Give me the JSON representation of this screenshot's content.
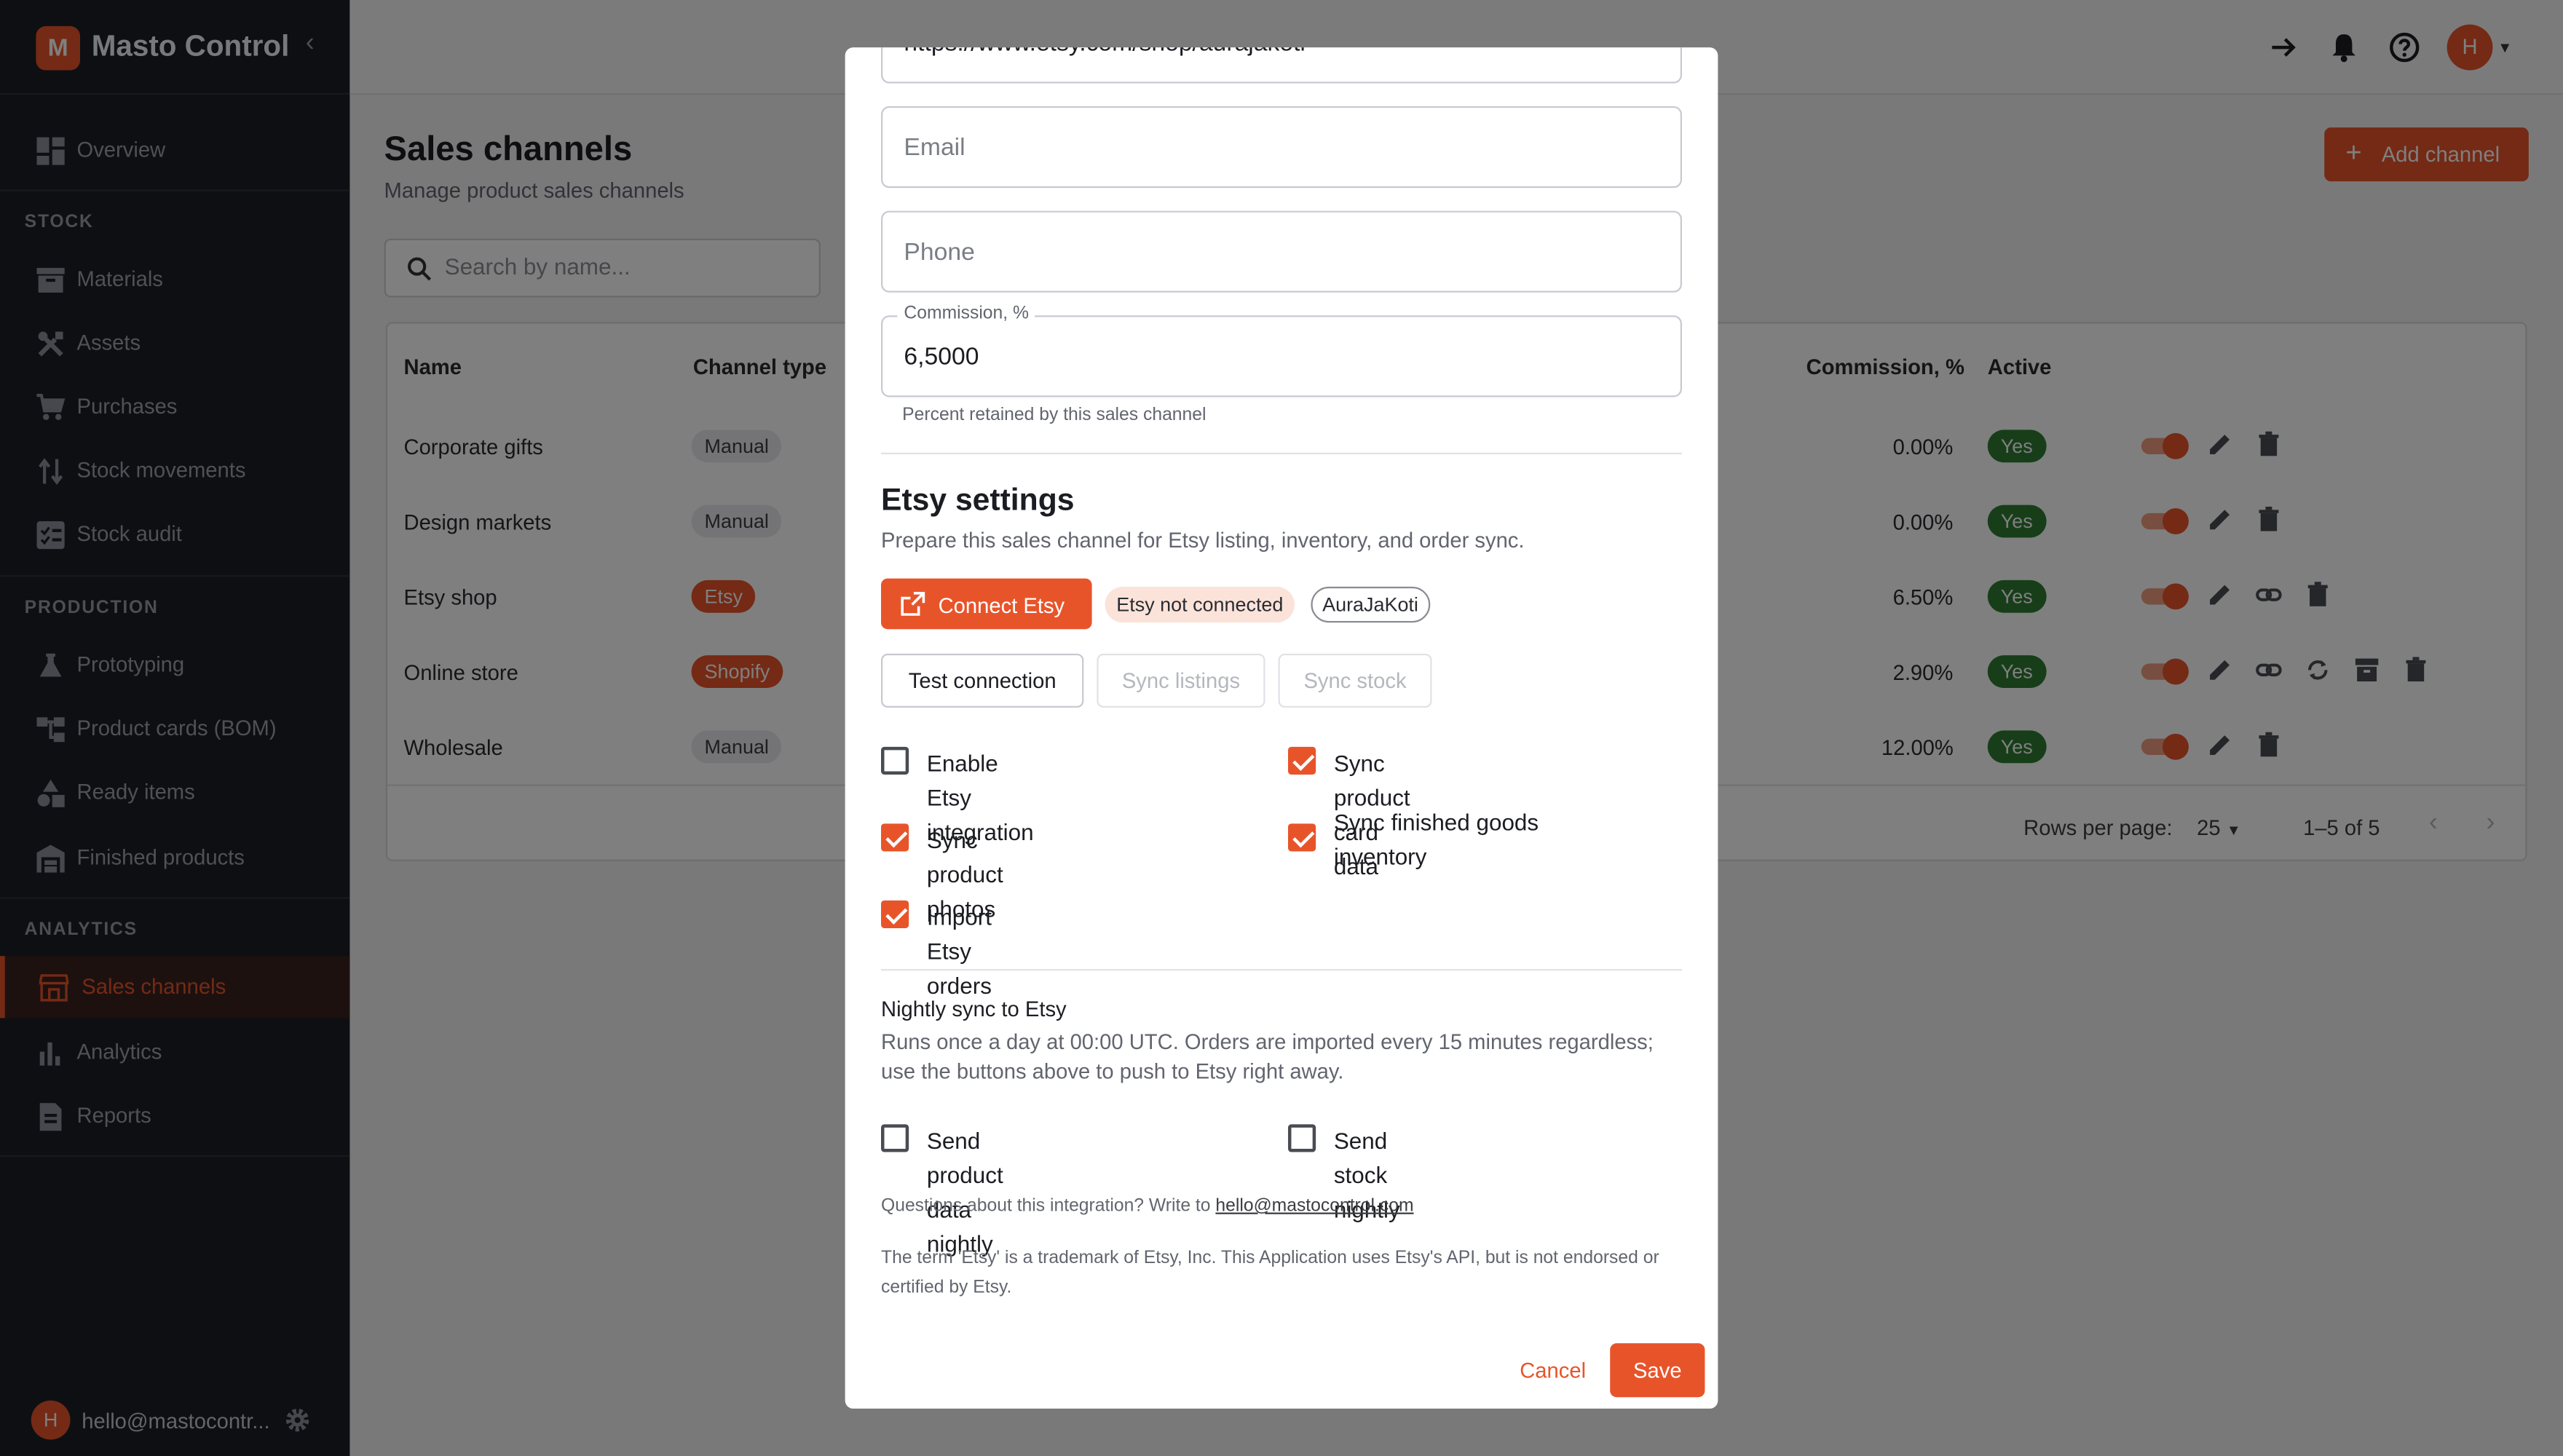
{
  "app": {
    "name": "Masto Control",
    "logo_letter": "M",
    "accent": "#e8542a"
  },
  "sidebar": {
    "overview": "Overview",
    "sections": {
      "stock": "STOCK",
      "production": "PRODUCTION",
      "analytics": "ANALYTICS"
    },
    "stock_items": [
      "Materials",
      "Assets",
      "Purchases",
      "Stock movements",
      "Stock audit"
    ],
    "production_items": [
      "Prototyping",
      "Product cards (BOM)",
      "Ready items",
      "Finished products"
    ],
    "analytics_items": [
      "Sales channels",
      "Analytics",
      "Reports"
    ],
    "active": "Sales channels",
    "user_initial": "H",
    "user_email": "hello@mastocontr..."
  },
  "topbar": {
    "avatar_initial": "H"
  },
  "page": {
    "title": "Sales channels",
    "subtitle": "Manage product sales channels",
    "add_button": "Add channel",
    "search_placeholder": "Search by name..."
  },
  "table": {
    "headers": {
      "name": "Name",
      "type": "Channel type",
      "commission": "Commission, %",
      "active": "Active"
    },
    "rows": [
      {
        "name": "Corporate gifts",
        "type": "Manual",
        "commission": "0.00%",
        "active": "Yes"
      },
      {
        "name": "Design markets",
        "type": "Manual",
        "commission": "0.00%",
        "active": "Yes"
      },
      {
        "name": "Etsy shop",
        "type": "Etsy",
        "commission": "6.50%",
        "active": "Yes"
      },
      {
        "name": "Online store",
        "type": "Shopify",
        "commission": "2.90%",
        "active": "Yes"
      },
      {
        "name": "Wholesale",
        "type": "Manual",
        "commission": "12.00%",
        "active": "Yes"
      }
    ],
    "rows_per_page_label": "Rows per page:",
    "rows_per_page": "25",
    "range": "1–5 of 5"
  },
  "modal": {
    "url_value": "https://www.etsy.com/shop/aurajakoti",
    "email_placeholder": "Email",
    "phone_placeholder": "Phone",
    "commission_label": "Commission, %",
    "commission_value": "6,5000",
    "commission_helper": "Percent retained by this sales channel",
    "etsy_title": "Etsy settings",
    "etsy_subtitle": "Prepare this sales channel for Etsy listing, inventory, and order sync.",
    "connect_button": "Connect Etsy",
    "status_chip": "Etsy not connected",
    "shop_chip": "AuraJaKoti",
    "test_button": "Test connection",
    "sync_listings_button": "Sync listings",
    "sync_stock_button": "Sync stock",
    "checkboxes": [
      {
        "label": "Enable Etsy integration",
        "checked": false
      },
      {
        "label": "Sync product card data",
        "checked": true
      },
      {
        "label": "Sync product photos",
        "checked": true
      },
      {
        "label": "Sync finished goods inventory",
        "checked": true
      },
      {
        "label": "Import Etsy orders",
        "checked": true
      }
    ],
    "nightly_title": "Nightly sync to Etsy",
    "nightly_desc": "Runs once a day at 00:00 UTC. Orders are imported every 15 minutes regardless; use the buttons above to push to Etsy right away.",
    "nightly_checkboxes": [
      {
        "label": "Send product data nightly",
        "checked": false
      },
      {
        "label": "Send stock nightly",
        "checked": false
      }
    ],
    "questions_text": "Questions about this integration? Write to",
    "questions_email": "hello@mastocontrol.com",
    "trademark_text": "The term 'Etsy' is a trademark of Etsy, Inc. This Application uses Etsy's API, but is not endorsed or certified by Etsy.",
    "cancel": "Cancel",
    "save": "Save"
  }
}
